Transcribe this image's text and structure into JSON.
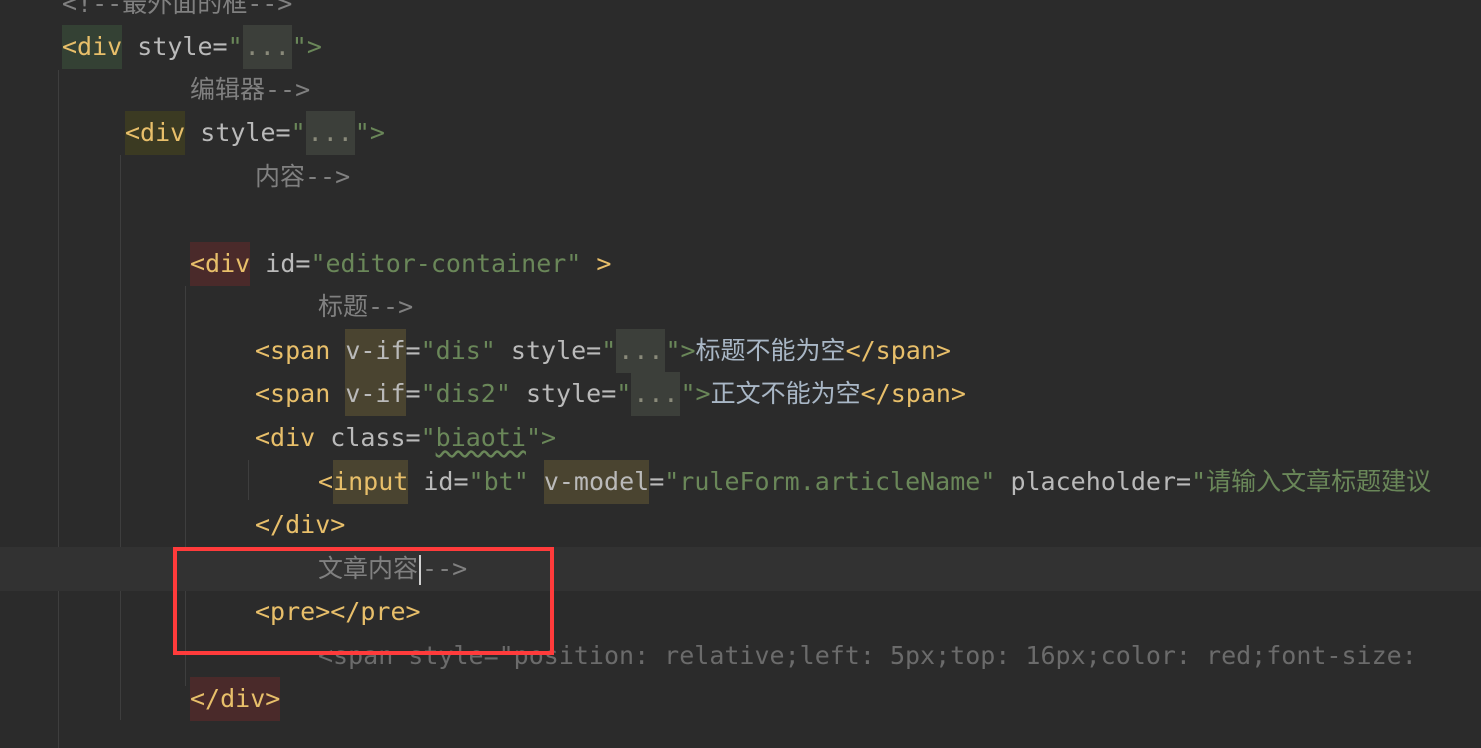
{
  "editor": {
    "lines": [
      {
        "id": "l0",
        "segments": [
          {
            "t": "<!--最外面的框-->",
            "c": "c-comment"
          }
        ]
      },
      {
        "id": "l1",
        "segments": [
          {
            "t": "<div",
            "c": "c-tag hl-green"
          },
          {
            "t": " style=",
            "c": "c-attr"
          },
          {
            "t": "\"",
            "c": "c-str"
          },
          {
            "t": "...",
            "c": "fold"
          },
          {
            "t": "\">",
            "c": "c-str"
          }
        ]
      },
      {
        "id": "l2",
        "segments": [
          {
            "t": "编辑器-->",
            "c": "c-comment"
          }
        ]
      },
      {
        "id": "l3",
        "segments": [
          {
            "t": "<div",
            "c": "c-tag hl-olive"
          },
          {
            "t": " style=",
            "c": "c-attr"
          },
          {
            "t": "\"",
            "c": "c-str"
          },
          {
            "t": "...",
            "c": "fold"
          },
          {
            "t": "\">",
            "c": "c-str"
          }
        ]
      },
      {
        "id": "l4",
        "segments": [
          {
            "t": "内容-->",
            "c": "c-comment"
          }
        ]
      },
      {
        "id": "l5",
        "segments": []
      },
      {
        "id": "l6",
        "segments": [
          {
            "t": "<div",
            "c": "c-tag hl-red"
          },
          {
            "t": " id=",
            "c": "c-attr"
          },
          {
            "t": "\"editor-container\"",
            "c": "c-str"
          },
          {
            "t": " >",
            "c": "c-tag"
          }
        ]
      },
      {
        "id": "l7",
        "segments": [
          {
            "t": "标题-->",
            "c": "c-comment"
          }
        ]
      },
      {
        "id": "l8",
        "segments": [
          {
            "t": "<span ",
            "c": "c-tag"
          },
          {
            "t": "v-if",
            "c": "c-attr hl-attr"
          },
          {
            "t": "=",
            "c": "c-attr"
          },
          {
            "t": "\"dis\"",
            "c": "c-str"
          },
          {
            "t": " style=",
            "c": "c-attr"
          },
          {
            "t": "\"",
            "c": "c-str"
          },
          {
            "t": "...",
            "c": "fold"
          },
          {
            "t": "\">",
            "c": "c-str"
          },
          {
            "t": "标题不能为空",
            "c": "c-text"
          },
          {
            "t": "</span>",
            "c": "c-tag"
          }
        ]
      },
      {
        "id": "l9",
        "segments": [
          {
            "t": "<span ",
            "c": "c-tag"
          },
          {
            "t": "v-if",
            "c": "c-attr hl-attr"
          },
          {
            "t": "=",
            "c": "c-attr"
          },
          {
            "t": "\"dis2\"",
            "c": "c-str"
          },
          {
            "t": " style=",
            "c": "c-attr"
          },
          {
            "t": "\"",
            "c": "c-str"
          },
          {
            "t": "...",
            "c": "fold"
          },
          {
            "t": "\">",
            "c": "c-str"
          },
          {
            "t": "正文不能为空",
            "c": "c-text"
          },
          {
            "t": "</span>",
            "c": "c-tag"
          }
        ]
      },
      {
        "id": "l10",
        "segments": [
          {
            "t": "<div ",
            "c": "c-tag"
          },
          {
            "t": "class=",
            "c": "c-attr"
          },
          {
            "t": "\"",
            "c": "c-str"
          },
          {
            "t": "biaoti",
            "c": "c-str squiggle"
          },
          {
            "t": "\">",
            "c": "c-str"
          }
        ]
      },
      {
        "id": "l11",
        "segments": [
          {
            "t": "<",
            "c": "c-tag"
          },
          {
            "t": "input",
            "c": "c-tag hl-attr"
          },
          {
            "t": " id=",
            "c": "c-attr"
          },
          {
            "t": "\"bt\"",
            "c": "c-str"
          },
          {
            "t": " ",
            "c": "c-attr"
          },
          {
            "t": "v-model",
            "c": "c-attr hl-attr"
          },
          {
            "t": "=",
            "c": "c-attr"
          },
          {
            "t": "\"ruleForm.articleName\"",
            "c": "c-str"
          },
          {
            "t": " placeholder=",
            "c": "c-attr"
          },
          {
            "t": "\"请输入文章标题建议",
            "c": "c-str"
          }
        ]
      },
      {
        "id": "l12",
        "segments": [
          {
            "t": "</div>",
            "c": "c-tag"
          }
        ]
      },
      {
        "id": "l13",
        "segments": [
          {
            "t": "文章内容",
            "c": "c-comment"
          },
          {
            "t": "|",
            "c": "caret"
          },
          {
            "t": "-->",
            "c": "c-comment"
          }
        ]
      },
      {
        "id": "l14",
        "segments": [
          {
            "t": "<pre></pre>",
            "c": "c-tag"
          }
        ]
      },
      {
        "id": "l15",
        "segments": [
          {
            "t": "<span style=\"position: relative;left: 5px;top: 16px;color: red;font-size:",
            "c": "c-faded"
          }
        ]
      },
      {
        "id": "l16",
        "segments": [
          {
            "t": "</div>",
            "c": "c-tag hl-red"
          }
        ]
      }
    ]
  }
}
